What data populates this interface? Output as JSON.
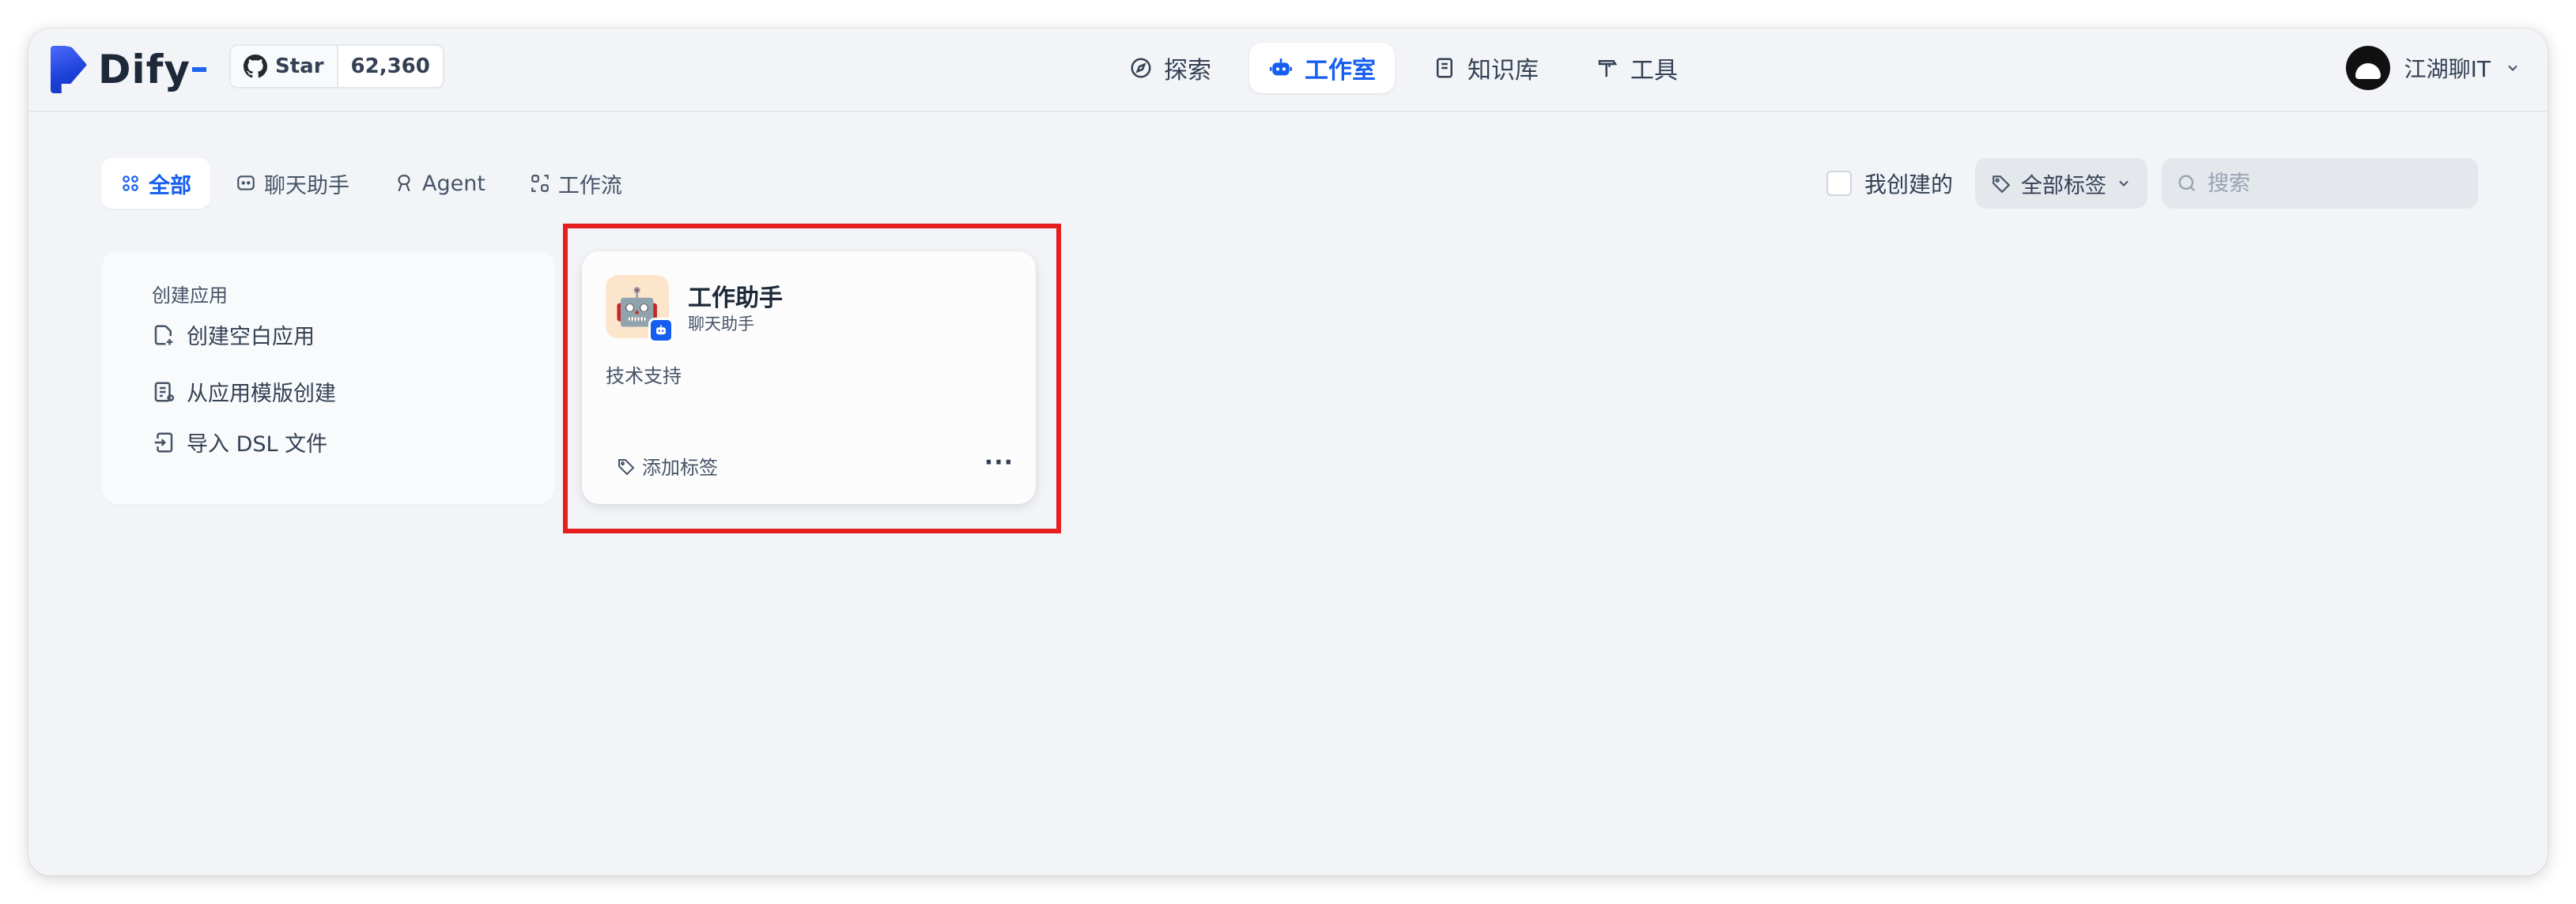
{
  "header": {
    "logo_text": "Dify",
    "github": {
      "label": "Star",
      "count": "62,360"
    },
    "nav": [
      {
        "label": "探索",
        "icon": "compass-icon"
      },
      {
        "label": "工作室",
        "icon": "robot-icon"
      },
      {
        "label": "知识库",
        "icon": "book-icon"
      },
      {
        "label": "工具",
        "icon": "hammer-icon"
      }
    ],
    "user": {
      "name": "江湖聊IT"
    }
  },
  "toolbar": {
    "tabs": [
      {
        "label": "全部",
        "icon": "grid-icon"
      },
      {
        "label": "聊天助手",
        "icon": "chat-icon"
      },
      {
        "label": "Agent",
        "icon": "agent-icon"
      },
      {
        "label": "工作流",
        "icon": "workflow-icon"
      }
    ],
    "my_created_label": "我创建的",
    "tag_filter_label": "全部标签",
    "search_placeholder": "搜索"
  },
  "create_card": {
    "title": "创建应用",
    "items": [
      {
        "label": "创建空白应用",
        "icon": "new-file-icon"
      },
      {
        "label": "从应用模版创建",
        "icon": "template-icon"
      },
      {
        "label": "导入 DSL 文件",
        "icon": "import-icon"
      }
    ]
  },
  "apps": [
    {
      "name": "工作助手",
      "type": "聊天助手",
      "description": "技术支持",
      "icon_emoji": "🤖",
      "add_tag_label": "添加标签",
      "more_label": "···"
    }
  ],
  "colors": {
    "accent": "#155eef",
    "highlight": "#e51e1e",
    "background": "#f2f4f7"
  }
}
